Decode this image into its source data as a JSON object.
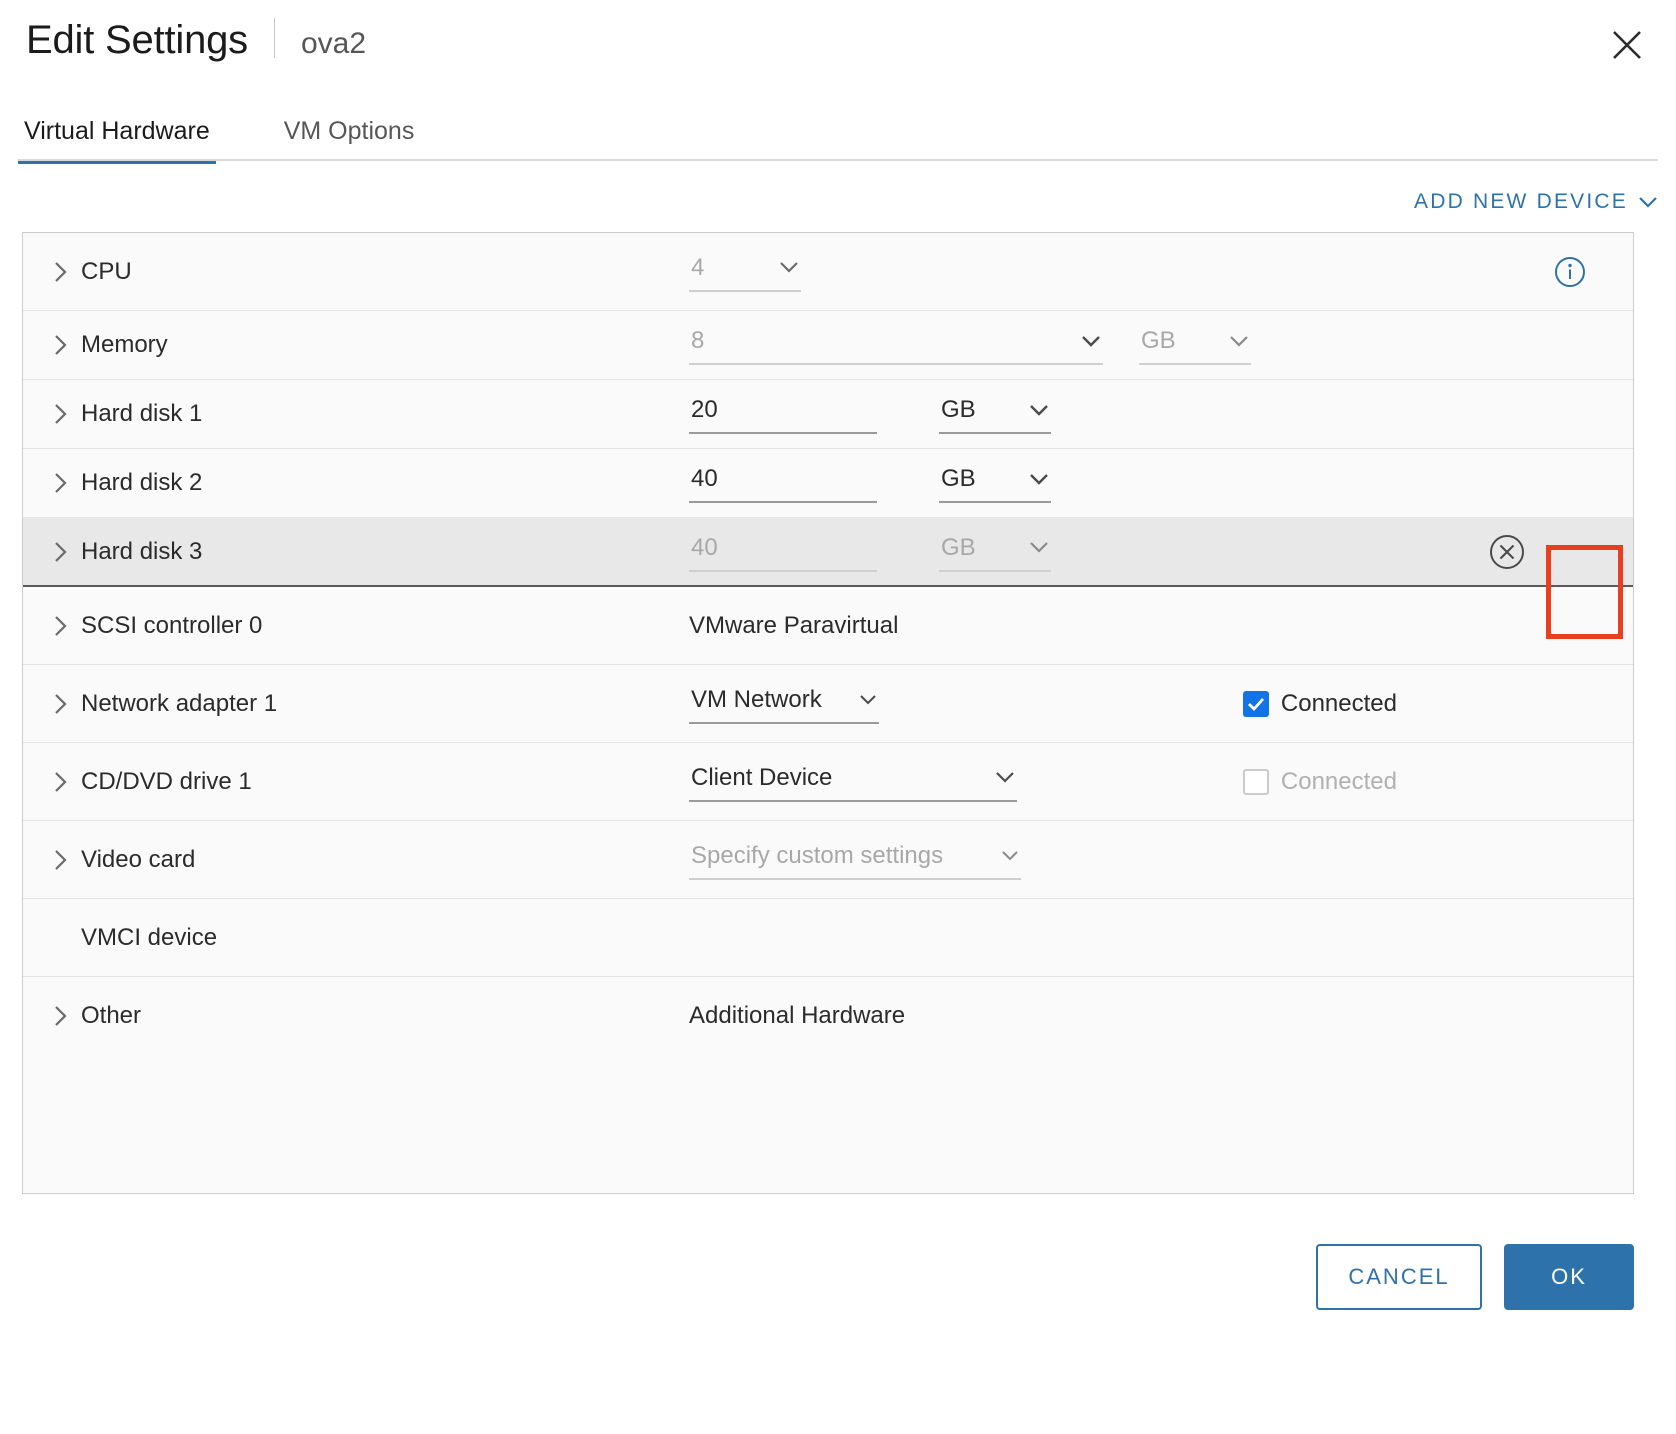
{
  "header": {
    "title": "Edit Settings",
    "subtitle": "ova2",
    "close_icon": "close-icon"
  },
  "tabs": [
    {
      "label": "Virtual Hardware",
      "active": true
    },
    {
      "label": "VM Options",
      "active": false
    }
  ],
  "toolbar": {
    "add_new_device": "ADD NEW DEVICE",
    "chevron_icon": "chevron-down-icon"
  },
  "colors": {
    "accent_blue": "#2e72ab",
    "checkbox_blue": "#1273e6",
    "highlight_red": "#e8401f",
    "row_selected_bg": "#e8e8e8",
    "table_bg": "#fafafa"
  },
  "devices": [
    {
      "name": "CPU",
      "expandable": true,
      "value": "4",
      "unit": null,
      "disabled": true,
      "info_icon": "info-icon"
    },
    {
      "name": "Memory",
      "expandable": true,
      "value": "8",
      "unit": "GB",
      "disabled": true
    },
    {
      "name": "Hard disk 1",
      "expandable": true,
      "value": "20",
      "unit": "GB",
      "disabled": false
    },
    {
      "name": "Hard disk 2",
      "expandable": true,
      "value": "40",
      "unit": "GB",
      "disabled": false
    },
    {
      "name": "Hard disk 3",
      "expandable": true,
      "value": "40",
      "unit": "GB",
      "disabled": true,
      "selected": true,
      "remove_icon": "remove-circle-icon"
    },
    {
      "name": "SCSI controller 0",
      "expandable": true,
      "value": "VMware Paravirtual",
      "type": "text"
    },
    {
      "name": "Network adapter 1",
      "expandable": true,
      "value": "VM Network",
      "checkbox_label": "Connected",
      "checked": true
    },
    {
      "name": "CD/DVD drive 1",
      "expandable": true,
      "value": "Client Device",
      "checkbox_label": "Connected",
      "checked": false
    },
    {
      "name": "Video card",
      "expandable": true,
      "value": "Specify custom settings",
      "disabled": true
    },
    {
      "name": "VMCI device",
      "expandable": false,
      "value": "",
      "type": "text"
    },
    {
      "name": "Other",
      "expandable": true,
      "value": "Additional Hardware",
      "type": "text"
    }
  ],
  "footer": {
    "cancel_label": "CANCEL",
    "ok_label": "OK"
  }
}
